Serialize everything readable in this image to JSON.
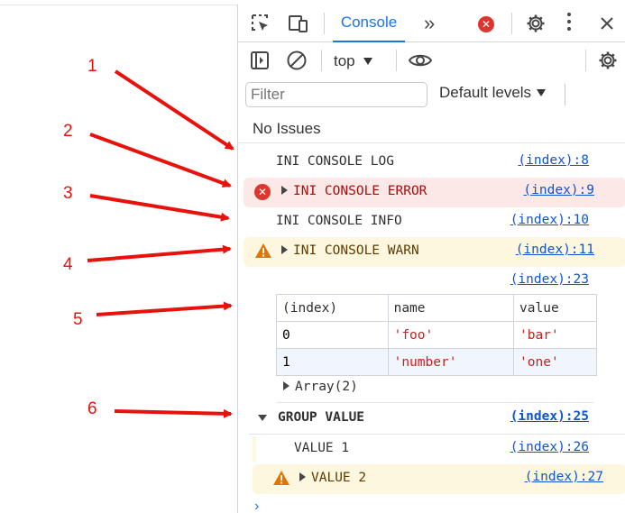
{
  "annotations": [
    "1",
    "2",
    "3",
    "4",
    "5",
    "6"
  ],
  "tabs": {
    "console_label": "Console",
    "more_tabs": "»"
  },
  "toolbar": {
    "context": "top",
    "filter_placeholder": "Filter",
    "levels_label": "Default levels"
  },
  "issues_text": "No Issues",
  "console": {
    "log": {
      "text": "INI CONSOLE LOG",
      "source": "(index):8"
    },
    "error": {
      "text": "INI CONSOLE ERROR",
      "source": "(index):9"
    },
    "info": {
      "text": "INI CONSOLE INFO",
      "source": "(index):10"
    },
    "warn": {
      "text": "INI CONSOLE WARN",
      "source": "(index):11"
    },
    "table_source": "(index):23",
    "table": {
      "headers": [
        "(index)",
        "name",
        "value"
      ],
      "rows": [
        [
          "0",
          "'foo'",
          "'bar'"
        ],
        [
          "1",
          "'number'",
          "'one'"
        ]
      ]
    },
    "array_label": "Array(2)",
    "group": {
      "label": "GROUP VALUE",
      "source": "(index):25"
    },
    "group_log": {
      "text": "VALUE 1",
      "source": "(index):26"
    },
    "group_warn": {
      "text": "VALUE 2",
      "source": "(index):27"
    },
    "prompt": "›"
  },
  "colors": {
    "accent": "#1a73e8",
    "annotation": "#e8120c",
    "error_bg": "#fce8e6",
    "warn_bg": "#fef7e0"
  }
}
